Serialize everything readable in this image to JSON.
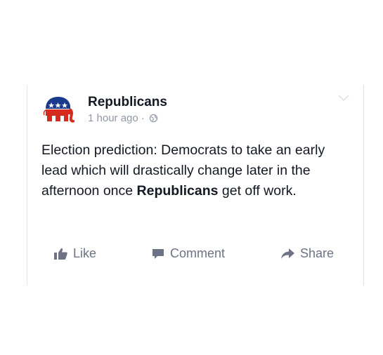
{
  "post": {
    "author": "Republicans",
    "timestamp": "1 hour ago",
    "separator": "·",
    "privacy_icon": "globe-icon",
    "avatar_icon": "gop-elephant-logo",
    "text_before": "Election prediction: Democrats to take an early lead which will drastically change later in the afternoon once ",
    "text_bold": "Republicans",
    "text_after": " get off work."
  },
  "actions": {
    "like_label": "Like",
    "comment_label": "Comment",
    "share_label": "Share"
  },
  "colors": {
    "text": "#141823",
    "meta": "#9197a3",
    "action": "#6d7384",
    "elephant_blue": "#1a3a8c",
    "elephant_red": "#d52b1e"
  }
}
